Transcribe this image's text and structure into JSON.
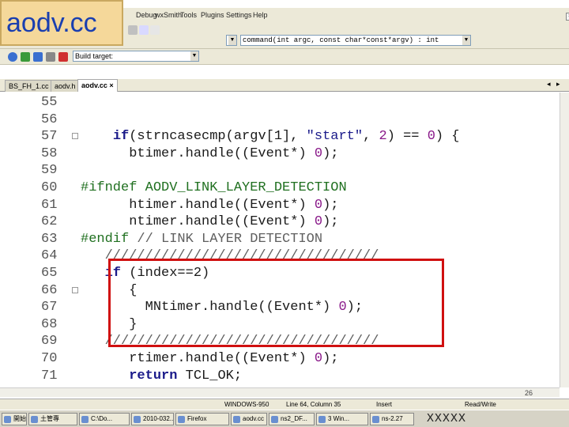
{
  "overlay": {
    "title": "aodv.cc"
  },
  "menu": {
    "items": [
      "Debug",
      "wxSmith",
      "Tools",
      "Plugins",
      "Settings",
      "Help"
    ]
  },
  "toolbar": {
    "function_combo": "command(int argc, const char*const*argv) : int",
    "build_target_label": "Build target:"
  },
  "tabs": [
    {
      "label": "BS_FH_1.cc",
      "active": false
    },
    {
      "label": "aodv.h",
      "active": false
    },
    {
      "label": "aodv.cc",
      "active": true
    }
  ],
  "editor": {
    "lines": [
      {
        "n": "55",
        "code": []
      },
      {
        "n": "56",
        "code": []
      },
      {
        "n": "57",
        "fold": true,
        "code": [
          [
            "    ",
            ""
          ],
          [
            "if",
            "kw"
          ],
          [
            "(strncasecmp(argv[1], ",
            ""
          ],
          [
            "\"start\"",
            "str"
          ],
          [
            ", ",
            ""
          ],
          [
            "2",
            "num"
          ],
          [
            ") == ",
            ""
          ],
          [
            "0",
            "num"
          ],
          [
            ") {",
            ""
          ]
        ]
      },
      {
        "n": "58",
        "code": [
          [
            "      btimer.handle((Event*) ",
            ""
          ],
          [
            "0",
            "num"
          ],
          [
            ");",
            ""
          ]
        ]
      },
      {
        "n": "59",
        "code": []
      },
      {
        "n": "60",
        "code": [
          [
            "#ifndef AODV_LINK_LAYER_DETECTION",
            "pre"
          ]
        ]
      },
      {
        "n": "61",
        "code": [
          [
            "      htimer.handle((Event*) ",
            ""
          ],
          [
            "0",
            "num"
          ],
          [
            ");",
            ""
          ]
        ]
      },
      {
        "n": "62",
        "code": [
          [
            "      ntimer.handle((Event*) ",
            ""
          ],
          [
            "0",
            "num"
          ],
          [
            ");",
            ""
          ]
        ]
      },
      {
        "n": "63",
        "code": [
          [
            "#endif",
            "pre"
          ],
          [
            " // LINK LAYER DETECTION",
            "cmt"
          ]
        ]
      },
      {
        "n": "64",
        "code": [
          [
            "   //////////////////////////////////",
            "cmt"
          ]
        ]
      },
      {
        "n": "65",
        "code": [
          [
            "   ",
            ""
          ],
          [
            "if",
            "kw"
          ],
          [
            " (index==2)",
            ""
          ]
        ]
      },
      {
        "n": "66",
        "fold": true,
        "code": [
          [
            "      {",
            ""
          ]
        ]
      },
      {
        "n": "67",
        "code": [
          [
            "        MNtimer.handle((Event*) ",
            ""
          ],
          [
            "0",
            "num"
          ],
          [
            ");",
            ""
          ]
        ]
      },
      {
        "n": "68",
        "code": [
          [
            "      }",
            ""
          ]
        ]
      },
      {
        "n": "69",
        "code": [
          [
            "   //////////////////////////////////",
            "cmt"
          ]
        ]
      },
      {
        "n": "70",
        "code": [
          [
            "      rtimer.handle((Event*) ",
            ""
          ],
          [
            "0",
            "num"
          ],
          [
            ");",
            ""
          ]
        ]
      },
      {
        "n": "71",
        "code": [
          [
            "      ",
            ""
          ],
          [
            "return",
            "kw"
          ],
          [
            " TCL_OK;",
            ""
          ]
        ]
      }
    ],
    "slide_number": "26"
  },
  "status": {
    "encoding": "WINDOWS-950",
    "position": "Line 64, Column 35",
    "mode": "Insert",
    "access": "Read/Write"
  },
  "taskbar": {
    "buttons": [
      "開始",
      "土管專",
      "C:\\Do...",
      "2010-032...",
      "Firefox",
      "aodv.cc",
      "ns2_DF...",
      "3 Win...",
      "ns-2.27",
      "",
      ""
    ],
    "tray_text": "XXXXX"
  },
  "colors": {
    "title_bg": "#f5d89a",
    "title_text": "#1a3fb0",
    "highlight": "#d01010",
    "chrome": "#ece9d8"
  }
}
